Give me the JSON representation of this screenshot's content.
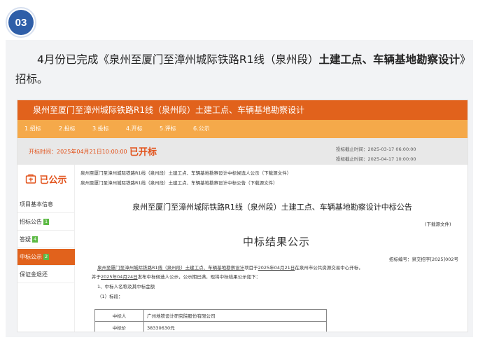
{
  "section_badge": "03",
  "article": {
    "intro_plain": "4月份已完成《泉州至厦门至漳州城际铁路R1线（泉州段）",
    "intro_bold": "土建工点、车辆基地勘察设计",
    "intro_tail": "》招标。"
  },
  "screenshot": {
    "title": "泉州至厦门至漳州城际铁路R1线（泉州段）土建工点、车辆基地勘察设计",
    "steps": [
      "1.招标",
      "2.投标",
      "3.投标",
      "4.开标",
      "5.评标",
      "6.公示"
    ],
    "start_label": "开标时间：2025年04月21日10:00:00",
    "start_status": "已开标",
    "time_info": [
      "投标截止时间：2025-03-17 06:00:00",
      "投标截止时间：2025-04-17 10:00:00"
    ],
    "sidebar": {
      "published": "已公示",
      "items": [
        {
          "label": "项目基本信息",
          "count": ""
        },
        {
          "label": "招标公告",
          "count": "1"
        },
        {
          "label": "答疑",
          "count": "4"
        },
        {
          "label": "中标公示",
          "count": "2"
        },
        {
          "label": "保证金退还",
          "count": ""
        }
      ]
    },
    "links": [
      "泉州至厦门至漳州城际铁路R1线（泉州段）土建工点、车辆基地勘察设计中标候选人公示（下载源文件）",
      "泉州至厦门至漳州城际铁路R1线（泉州段）土建工点、车辆基地勘察设计中标公告（下载源文件）"
    ],
    "notice_title": "泉州至厦门至漳州城际铁路R1线（泉州段）土建工点、车辆基地勘察设计中标公告",
    "download_label": "(下载源文件)",
    "doc": {
      "heading": "中标结果公示",
      "ref": "招标编号：泉交招字[2025]002号",
      "line1_a": "泉州至厦门至漳州城际铁路R1线（泉州段）土建工点、车辆基地勘察设计",
      "line1_b": "项目于",
      "line1_date": "2025年04月21日",
      "line1_c": "在泉州市公共资源交易中心开标，",
      "line2_a": "并于",
      "line2_date": "2025年04月24日",
      "line2_b": "发布中标候选人公示，公示期已满，现将中标结果公示如下：",
      "line3": "1、中标人名称及其中标金额",
      "line4": "（1）标段：",
      "table": [
        {
          "key": "中标人",
          "value": "广州地铁设计研究院股份有限公司"
        },
        {
          "key": "中标价",
          "value": "38330630元"
        }
      ]
    }
  }
}
